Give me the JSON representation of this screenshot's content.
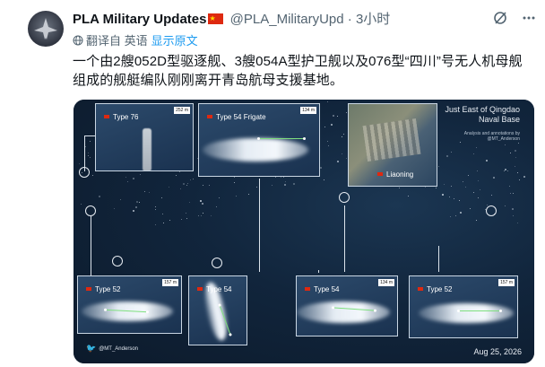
{
  "tweet": {
    "author_name": "PLA Military Updates",
    "author_flag": "🇨🇳",
    "handle": "@PLA_MilitaryUpd",
    "separator": "·",
    "time": "3小时",
    "translated_from": "翻译自 英语",
    "show_original": "显示原文",
    "text": "一个由2艘052D型驱逐舰、3艘054A型护卫舰以及076型“四川”号无人机母舰组成的舰艇编队刚刚离开青岛航母支援基地。"
  },
  "media": {
    "title_line1": "Just East of Qingdao",
    "title_line2": "Naval Base",
    "analysis_line1": "Analysis and annotations by",
    "analysis_line2": "@MT_Anderson",
    "credit": "@MT_Anderson",
    "date": "Aug 25, 2026",
    "panels": [
      {
        "label": "Type 76",
        "scale": "252 m"
      },
      {
        "label": "Type 54 Frigate",
        "scale": "134 m"
      },
      {
        "label": "Liaoning"
      },
      {
        "label": "Type 52",
        "scale": "157 m"
      },
      {
        "label": "Type 54"
      },
      {
        "label": "Type 54",
        "scale": "134 m"
      },
      {
        "label": "Type 52",
        "scale": "157 m"
      }
    ]
  },
  "icons": {
    "grok": "grok-icon",
    "more": "more-icon",
    "globe": "globe-icon",
    "twitter": "twitter-bird-icon",
    "flag": "china-flag-icon"
  }
}
